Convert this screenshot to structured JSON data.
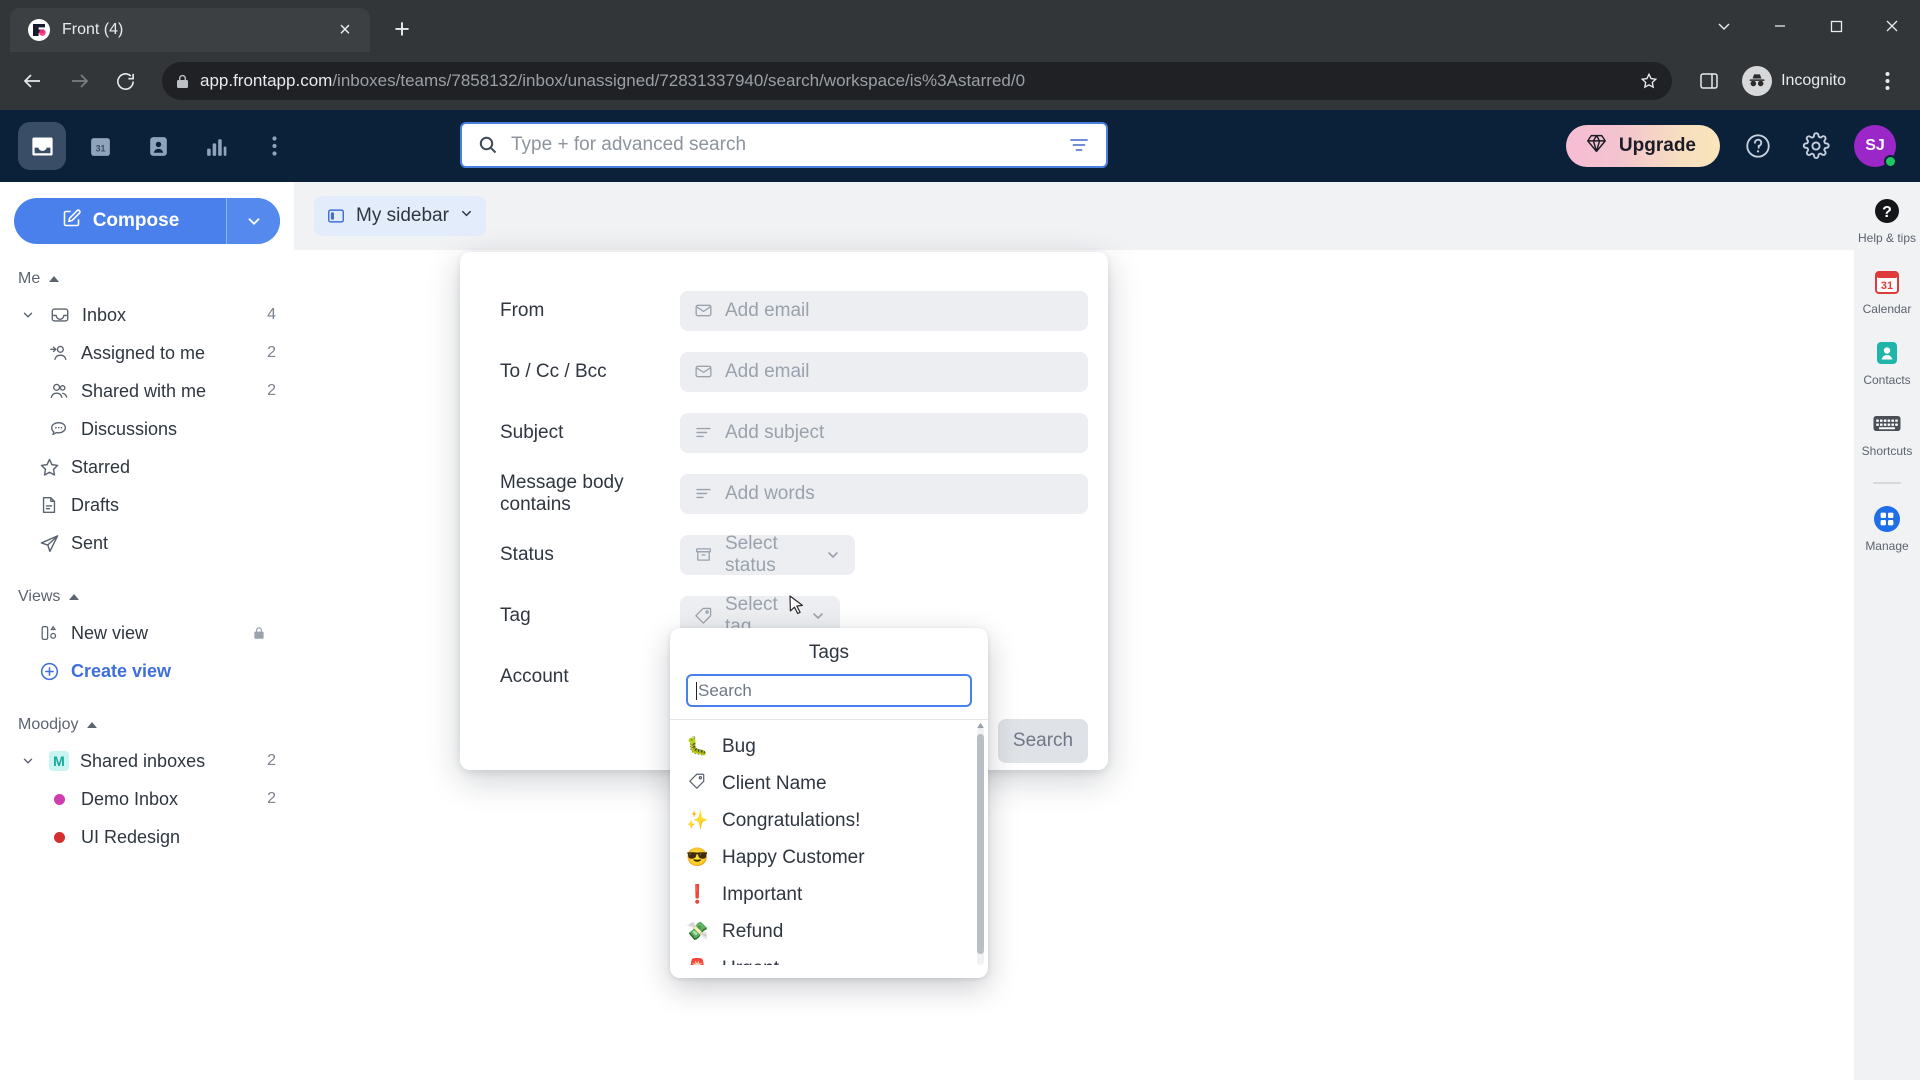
{
  "browser": {
    "tab": {
      "title": "Front (4)",
      "favicon": "front-logo-icon",
      "close": "×"
    },
    "new_tab": "+",
    "window": {
      "minimize": "minimize-icon",
      "maximize": "maximize-icon",
      "close": "close-icon",
      "chevron": "chevron-down-icon"
    },
    "nav": {
      "back": "back-icon",
      "forward": "forward-icon",
      "reload": "reload-icon"
    },
    "url": {
      "lock": "lock-icon",
      "host": "app.frontapp.com",
      "path": "/inboxes/teams/7858132/inbox/unassigned/72831337940/search/workspace/is%3Astarred/0",
      "star": "bookmark-star-icon"
    },
    "sidepanel_icon": "side-panel-icon",
    "profile": {
      "label": "Incognito",
      "icon": "incognito-icon"
    },
    "menu": "kebab-menu-icon"
  },
  "app": {
    "topnav": [
      {
        "name": "inbox",
        "icon": "inbox-icon",
        "active": true
      },
      {
        "name": "calendar",
        "icon": "calendar-31-icon",
        "active": false
      },
      {
        "name": "contacts",
        "icon": "contact-card-icon",
        "active": false
      },
      {
        "name": "analytics",
        "icon": "bar-chart-icon",
        "active": false
      },
      {
        "name": "more",
        "icon": "kebab-menu-icon",
        "active": false
      }
    ],
    "search": {
      "placeholder": "Type + for advanced search",
      "value": "",
      "search_icon": "search-icon",
      "filter_icon": "filter-icon"
    },
    "upgrade_label": "Upgrade",
    "upgrade_icon": "diamond-icon",
    "help_icon": "question-circle-icon",
    "settings_icon": "gear-icon",
    "avatar_initials": "SJ"
  },
  "sidebar": {
    "compose_label": "Compose",
    "compose_icon": "compose-pencil-icon",
    "compose_chevron": "chevron-down-icon",
    "sections": [
      {
        "title": "Me",
        "collapse_icon": "chevron-up-icon",
        "items": [
          {
            "label": "Inbox",
            "icon": "inbox-open-icon",
            "count": "4",
            "caret": "chevron-down-icon",
            "indent": 0
          },
          {
            "label": "Assigned to me",
            "icon": "assigned-person-icon",
            "count": "2",
            "indent": 1
          },
          {
            "label": "Shared with me",
            "icon": "shared-people-icon",
            "count": "2",
            "indent": 1
          },
          {
            "label": "Discussions",
            "icon": "chat-bubble-icon",
            "count": "",
            "indent": 1
          },
          {
            "label": "Starred",
            "icon": "star-icon",
            "count": "",
            "indent": 0
          },
          {
            "label": "Drafts",
            "icon": "draft-doc-icon",
            "count": "",
            "indent": 0
          },
          {
            "label": "Sent",
            "icon": "paper-plane-icon",
            "count": "",
            "indent": 0
          }
        ]
      },
      {
        "title": "Views",
        "collapse_icon": "chevron-up-icon",
        "items": [
          {
            "label": "New view",
            "icon": "view-layout-icon",
            "count": "",
            "lock": "lock-icon",
            "indent": 1
          },
          {
            "label": "Create view",
            "icon": "plus-circle-icon",
            "count": "",
            "link": true,
            "indent": 1
          }
        ]
      },
      {
        "title": "Moodjoy",
        "collapse_icon": "chevron-up-icon",
        "items": [
          {
            "label": "Shared inboxes",
            "icon": "moodjoy-badge",
            "badge_letter": "M",
            "count": "2",
            "caret": "chevron-down-icon",
            "indent": 0
          },
          {
            "label": "Demo Inbox",
            "icon": "dot",
            "dot_color": "#cf3eb0",
            "count": "2",
            "indent": 1
          },
          {
            "label": "UI Redesign",
            "icon": "dot",
            "dot_color": "#d32f2f",
            "count": "",
            "indent": 1
          }
        ]
      }
    ]
  },
  "center": {
    "my_sidebar_label": "My sidebar",
    "my_sidebar_icon": "panel-icon",
    "my_sidebar_chevron": "chevron-down-icon"
  },
  "right_rail": [
    {
      "label": "Help & tips",
      "icon": "question-mark-black-icon"
    },
    {
      "label": "Calendar",
      "icon": "calendar-31-red-icon"
    },
    {
      "label": "Contacts",
      "icon": "contacts-teal-icon"
    },
    {
      "label": "Shortcuts",
      "icon": "keyboard-icon"
    },
    {
      "label": "Manage",
      "icon": "manage-grid-blue-icon"
    }
  ],
  "search_panel": {
    "rows": [
      {
        "label": "From",
        "placeholder": "Add email",
        "icon": "envelope-icon",
        "type": "text"
      },
      {
        "label": "To / Cc / Bcc",
        "placeholder": "Add email",
        "icon": "envelope-icon",
        "type": "text"
      },
      {
        "label": "Subject",
        "placeholder": "Add subject",
        "icon": "lines-icon",
        "type": "text"
      },
      {
        "label": "Message body contains",
        "placeholder": "Add words",
        "icon": "lines-icon",
        "type": "text"
      },
      {
        "label": "Status",
        "placeholder": "Select status",
        "icon": "archive-box-icon",
        "type": "select",
        "chevron": "chevron-down-icon"
      },
      {
        "label": "Tag",
        "placeholder": "Select tag",
        "icon": "tag-icon",
        "type": "select",
        "chevron": "chevron-down-icon"
      },
      {
        "label": "Account",
        "placeholder": "",
        "icon": "",
        "type": "blank"
      }
    ],
    "submit_label": "Search"
  },
  "tags_popover": {
    "title": "Tags",
    "search_placeholder": "Search",
    "search_value": "",
    "items": [
      {
        "label": "Bug",
        "emoji": "🐛"
      },
      {
        "label": "Client Name",
        "emoji": ""
      },
      {
        "label": "Congratulations!",
        "emoji": "✨"
      },
      {
        "label": "Happy Customer",
        "emoji": "😎"
      },
      {
        "label": "Important",
        "emoji": "❗"
      },
      {
        "label": "Refund",
        "emoji": "💸"
      },
      {
        "label": "Urgent",
        "emoji": "🚨"
      }
    ],
    "scroll_up_icon": "chevron-up-icon"
  },
  "colors": {
    "app_topbar": "#0b2039",
    "accent_blue": "#4a80ec",
    "link_blue": "#3f6fd8",
    "panel_bg": "#ffffff",
    "canvas": "#f1f2f4"
  }
}
